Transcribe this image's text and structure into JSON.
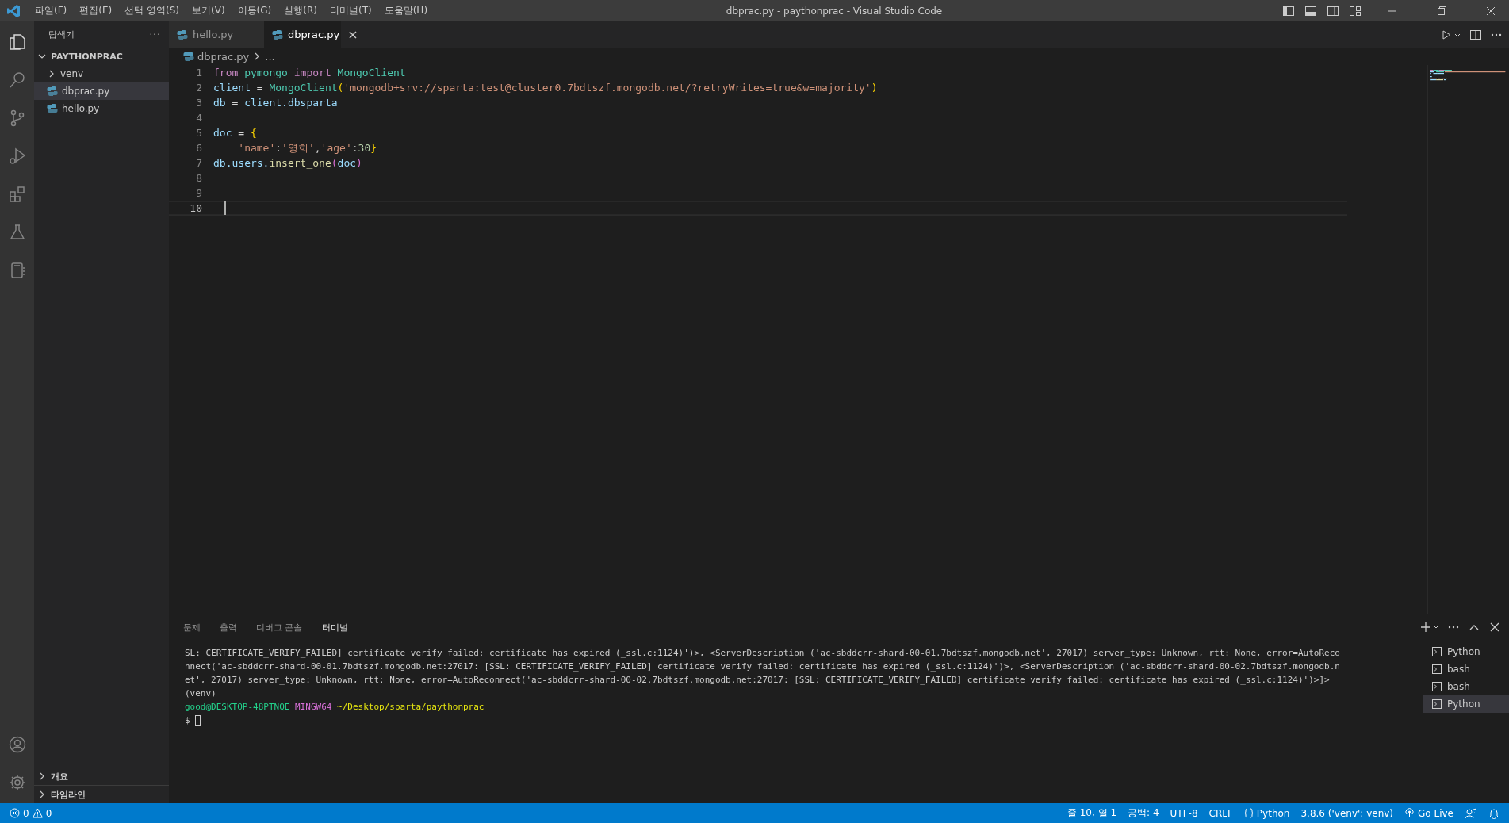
{
  "window": {
    "title": "dbprac.py - paythonprac - Visual Studio Code"
  },
  "menu": [
    "파일(F)",
    "편집(E)",
    "선택 영역(S)",
    "보기(V)",
    "이동(G)",
    "실행(R)",
    "터미널(T)",
    "도움말(H)"
  ],
  "sidebar": {
    "title": "탐색기",
    "more": "···",
    "folder": {
      "label": "PAYTHONPRAC",
      "expanded": true,
      "children": [
        {
          "label": "venv",
          "kind": "folder",
          "expanded": false,
          "selected": false
        },
        {
          "label": "dbprac.py",
          "kind": "python",
          "selected": true
        },
        {
          "label": "hello.py",
          "kind": "python",
          "selected": false
        }
      ]
    },
    "sections": [
      {
        "label": "개요",
        "expanded": false
      },
      {
        "label": "타임라인",
        "expanded": false
      }
    ]
  },
  "tabs": [
    {
      "label": "hello.py",
      "selected": false
    },
    {
      "label": "dbprac.py",
      "selected": true,
      "close": "×"
    }
  ],
  "breadcrumb": [
    "dbprac.py",
    "..."
  ],
  "editor": {
    "lines": [
      {
        "number": "1",
        "current": false,
        "tokens": [
          {
            "text": "from ",
            "kind": "keyword"
          },
          {
            "text": "pymongo ",
            "kind": "type"
          },
          {
            "text": "import ",
            "kind": "keyword"
          },
          {
            "text": "MongoClient",
            "kind": "type"
          }
        ]
      },
      {
        "number": "2",
        "current": false,
        "tokens": [
          {
            "text": "client",
            "kind": "variable"
          },
          {
            "text": " = ",
            "kind": "plain"
          },
          {
            "text": "MongoClient",
            "kind": "type"
          },
          {
            "text": "(",
            "kind": "bracket"
          },
          {
            "text": "'mongodb+srv://sparta:test@cluster0.7bdtszf.mongodb.net/?retryWrites=true&w=majority'",
            "kind": "string"
          },
          {
            "text": ")",
            "kind": "bracket"
          }
        ]
      },
      {
        "number": "3",
        "current": false,
        "tokens": [
          {
            "text": "db",
            "kind": "variable"
          },
          {
            "text": " = ",
            "kind": "plain"
          },
          {
            "text": "client",
            "kind": "variable"
          },
          {
            "text": ".dbsparta",
            "kind": "variable"
          }
        ]
      },
      {
        "number": "4",
        "current": false
      },
      {
        "number": "5",
        "current": false,
        "tokens": [
          {
            "text": "doc",
            "kind": "variable"
          },
          {
            "text": " = ",
            "kind": "plain"
          },
          {
            "text": "{",
            "kind": "bracket"
          }
        ]
      },
      {
        "number": "6",
        "current": false,
        "tokens": [
          {
            "text": "    'name'",
            "kind": "string"
          },
          {
            "text": ":",
            "kind": "plain"
          },
          {
            "text": "'영희'",
            "kind": "string"
          },
          {
            "text": ",",
            "kind": "plain"
          },
          {
            "text": "'age'",
            "kind": "string"
          },
          {
            "text": ":",
            "kind": "plain"
          },
          {
            "text": "30",
            "kind": "number"
          },
          {
            "text": "}",
            "kind": "bracket"
          }
        ]
      },
      {
        "number": "7",
        "current": false,
        "tokens": [
          {
            "text": "db",
            "kind": "variable"
          },
          {
            "text": ".users.",
            "kind": "variable"
          },
          {
            "text": "insert_one",
            "kind": "function"
          },
          {
            "text": "(",
            "kind": "bracket2"
          },
          {
            "text": "doc",
            "kind": "variable"
          },
          {
            "text": ")",
            "kind": "bracket2"
          }
        ]
      },
      {
        "number": "8",
        "current": false
      },
      {
        "number": "9",
        "current": false
      },
      {
        "number": "10",
        "current": true
      }
    ]
  },
  "panel": {
    "tabs": [
      {
        "label": "문제",
        "selected": false
      },
      {
        "label": "출력",
        "selected": false
      },
      {
        "label": "디버그 콘솔",
        "selected": false
      },
      {
        "label": "터미널",
        "selected": true
      }
    ],
    "terminal": [
      {
        "kind": "output",
        "segments": [
          {
            "text": "SL: CERTIFICATE_VERIFY_FAILED] certificate verify failed: certificate has expired (_ssl.c:1124)')>, <ServerDescription ('ac-sbddcrr-shard-00-01.7bdtszf.mongodb.net', 27017) server_type: Unknown, rtt: None, error=AutoReco",
            "kind": "plain"
          }
        ]
      },
      {
        "kind": "output",
        "segments": [
          {
            "text": "nnect('ac-sbddcrr-shard-00-01.7bdtszf.mongodb.net:27017: [SSL: CERTIFICATE_VERIFY_FAILED] certificate verify failed: certificate has expired (_ssl.c:1124)')>, <ServerDescription ('ac-sbddcrr-shard-00-02.7bdtszf.mongodb.n",
            "kind": "plain"
          }
        ]
      },
      {
        "kind": "output",
        "segments": [
          {
            "text": "et', 27017) server_type: Unknown, rtt: None, error=AutoReconnect('ac-sbddcrr-shard-00-02.7bdtszf.mongodb.net:27017: [SSL: CERTIFICATE_VERIFY_FAILED] certificate verify failed: certificate has expired (_ssl.c:1124)')>]>",
            "kind": "plain"
          }
        ]
      },
      {
        "kind": "output",
        "segments": [
          {
            "text": "(venv)",
            "kind": "plain"
          }
        ]
      },
      {
        "kind": "prompt",
        "segments": [
          {
            "text": "good@DESKTOP-48PTNQE",
            "kind": "user"
          },
          {
            "text": " MINGW64",
            "kind": "host"
          },
          {
            "text": " ~/Desktop/sparta/paythonprac",
            "kind": "path"
          }
        ]
      },
      {
        "kind": "input",
        "segments": [
          {
            "text": "$ ",
            "kind": "plain"
          }
        ]
      }
    ],
    "sessions": [
      {
        "label": "Python",
        "selected": false
      },
      {
        "label": "bash",
        "selected": false
      },
      {
        "label": "bash",
        "selected": false
      },
      {
        "label": "Python",
        "selected": true
      }
    ]
  },
  "status_bar": {
    "errors": "0",
    "warnings": "0",
    "items": [
      {
        "text": "줄 10, 열 1",
        "kind": "text"
      },
      {
        "text": "공백: 4",
        "kind": "text"
      },
      {
        "text": "UTF-8",
        "kind": "text"
      },
      {
        "text": "CRLF",
        "kind": "text"
      },
      {
        "text": "Python",
        "kind": "language"
      },
      {
        "text": "3.8.6 ('venv': venv)",
        "kind": "text"
      },
      {
        "text": "Go Live",
        "kind": "live"
      },
      {
        "kind": "feedback"
      },
      {
        "kind": "bell"
      }
    ]
  }
}
